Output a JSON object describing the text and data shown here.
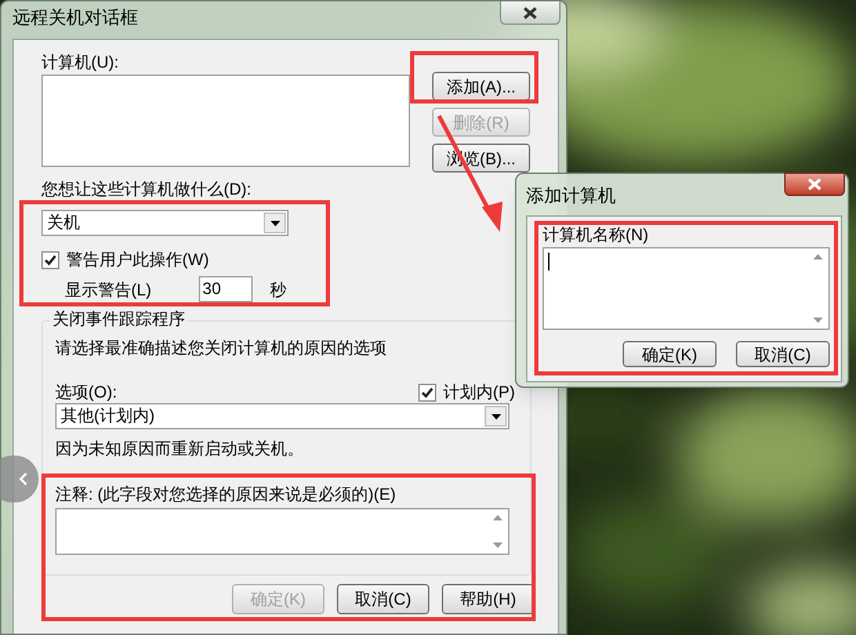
{
  "main_dialog": {
    "title": "远程关机对话框",
    "computers_label": "计算机(U):",
    "side_buttons": [
      {
        "label": "添加(A)...",
        "disabled": false
      },
      {
        "label": "删除(R)",
        "disabled": true
      },
      {
        "label": "浏览(B)...",
        "disabled": false
      }
    ],
    "action_label": "您想让这些计算机做什么(D):",
    "action_select": {
      "value": "关机"
    },
    "warn_checkbox": {
      "label": "警告用户此操作(W)",
      "checked": true
    },
    "warning_time": {
      "label": "显示警告(L)",
      "value": "30",
      "unit": "秒"
    },
    "tracker": {
      "title": "关闭事件跟踪程序",
      "instruction": "请选择最准确描述您关闭计算机的原因的选项",
      "option_label": "选项(O):",
      "planned_checkbox": {
        "label": "计划内(P)",
        "checked": true
      },
      "option_select": {
        "value": "其他(计划内)"
      },
      "description": "因为未知原因而重新启动或关机。",
      "comment_label": "注释: (此字段对您选择的原因来说是必须的)(E)"
    },
    "footer_buttons": [
      {
        "label": "确定(K)",
        "disabled": true
      },
      {
        "label": "取消(C)",
        "disabled": false
      },
      {
        "label": "帮助(H)",
        "disabled": false
      }
    ]
  },
  "add_dialog": {
    "title": "添加计算机",
    "name_label": "计算机名称(N)",
    "buttons": [
      {
        "label": "确定(K)",
        "disabled": false
      },
      {
        "label": "取消(C)",
        "disabled": false
      }
    ]
  }
}
